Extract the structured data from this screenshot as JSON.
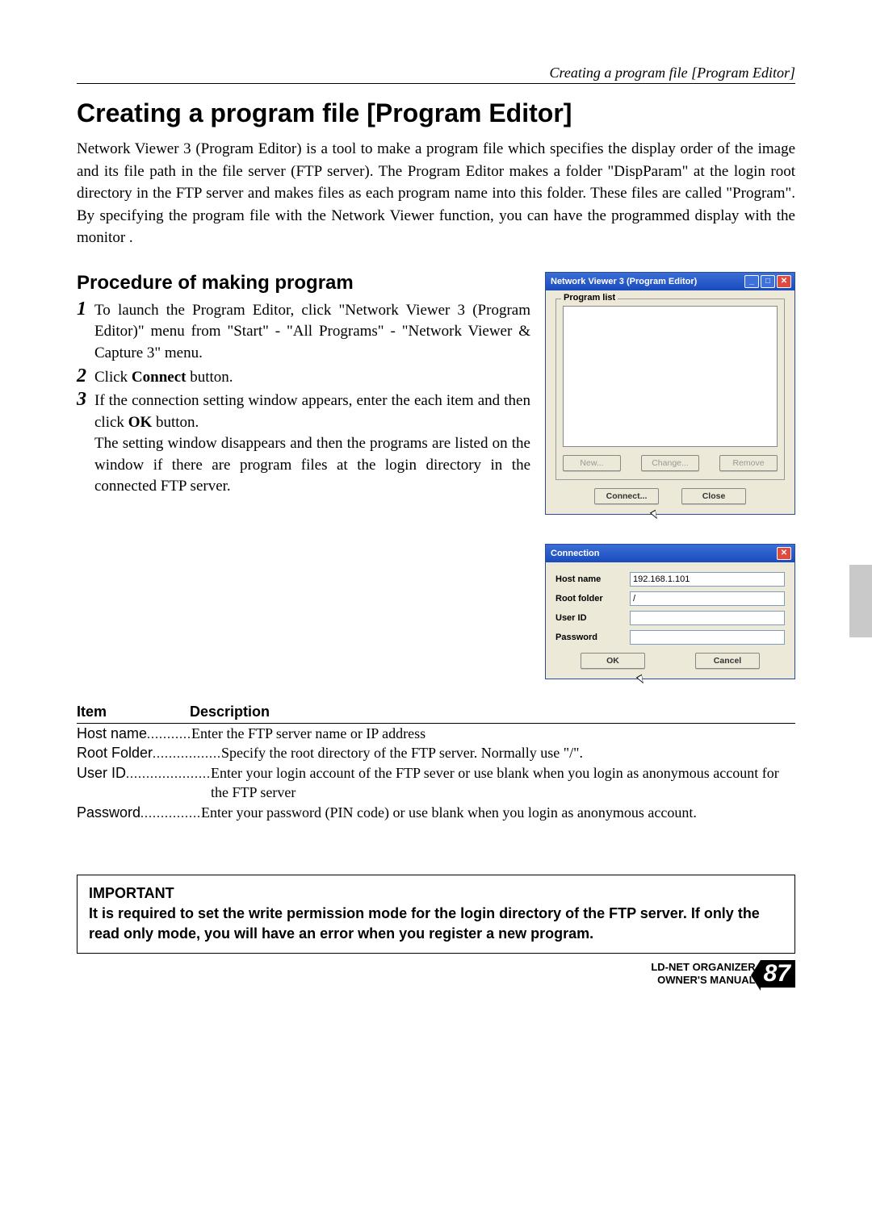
{
  "header": {
    "running_title": "Creating a program file [Program Editor]"
  },
  "title": "Creating a program file [Program Editor]",
  "intro": "Network Viewer 3 (Program Editor) is a tool to make a program file which specifies the display order of the image and its file path in the file server (FTP server). The Program Editor makes a folder \"DispParam\" at the login root directory in the FTP server and makes files as each program name into this folder. These files are called \"Program\". By specifying the program file with the Network Viewer function, you can have the programmed display with the monitor .",
  "procedure_title": "Procedure of making program",
  "steps": {
    "s1": "To launch the Program Editor, click \"Network Viewer 3 (Program Editor)\" menu from \"Start\" - \"All Programs\" - \"Network Viewer & Capture 3\" menu.",
    "s2a": "Click ",
    "s2b": "Connect",
    "s2c": " button.",
    "s3a": "If the connection setting window appears, enter the each item and then click ",
    "s3b": "OK",
    "s3c": " button.",
    "s3d": "The setting window disappears and then the programs are listed on the window if there are program files at the login directory in the connected FTP server."
  },
  "editor_window": {
    "title": "Network Viewer 3 (Program Editor)",
    "group": "Program list",
    "btn_new": "New...",
    "btn_change": "Change...",
    "btn_remove": "Remove",
    "btn_connect": "Connect...",
    "btn_close": "Close"
  },
  "connection_dialog": {
    "title": "Connection",
    "host_label": "Host name",
    "host_value": "192.168.1.101",
    "root_label": "Root folder",
    "root_value": "/",
    "user_label": "User ID",
    "user_value": "",
    "pass_label": "Password",
    "pass_value": "",
    "btn_ok": "OK",
    "btn_cancel": "Cancel"
  },
  "table": {
    "head_item": "Item",
    "head_desc": "Description",
    "rows": [
      {
        "item": "Host name",
        "dots": "...........",
        "desc": "Enter the FTP server name or IP address"
      },
      {
        "item": "Root Folder",
        "dots": ".................",
        "desc": "Specify the root directory of the FTP server. Normally use \"/\"."
      },
      {
        "item": "User ID",
        "dots": ".....................",
        "desc": "Enter your login account of the FTP sever or use blank when you login as anonymous account for the FTP server"
      },
      {
        "item": "Password",
        "dots": "...............",
        "desc": "Enter your password (PIN code) or use blank when you login as anonymous account."
      }
    ]
  },
  "important": {
    "heading": "IMPORTANT",
    "body": "It is required to set the write permission mode for the login directory of the FTP server. If only the read only mode, you will have an error when you register a new program."
  },
  "footer": {
    "product": "LD-NET ORGANIZER",
    "subtitle": "OWNER'S MANUAL",
    "page": "87"
  }
}
